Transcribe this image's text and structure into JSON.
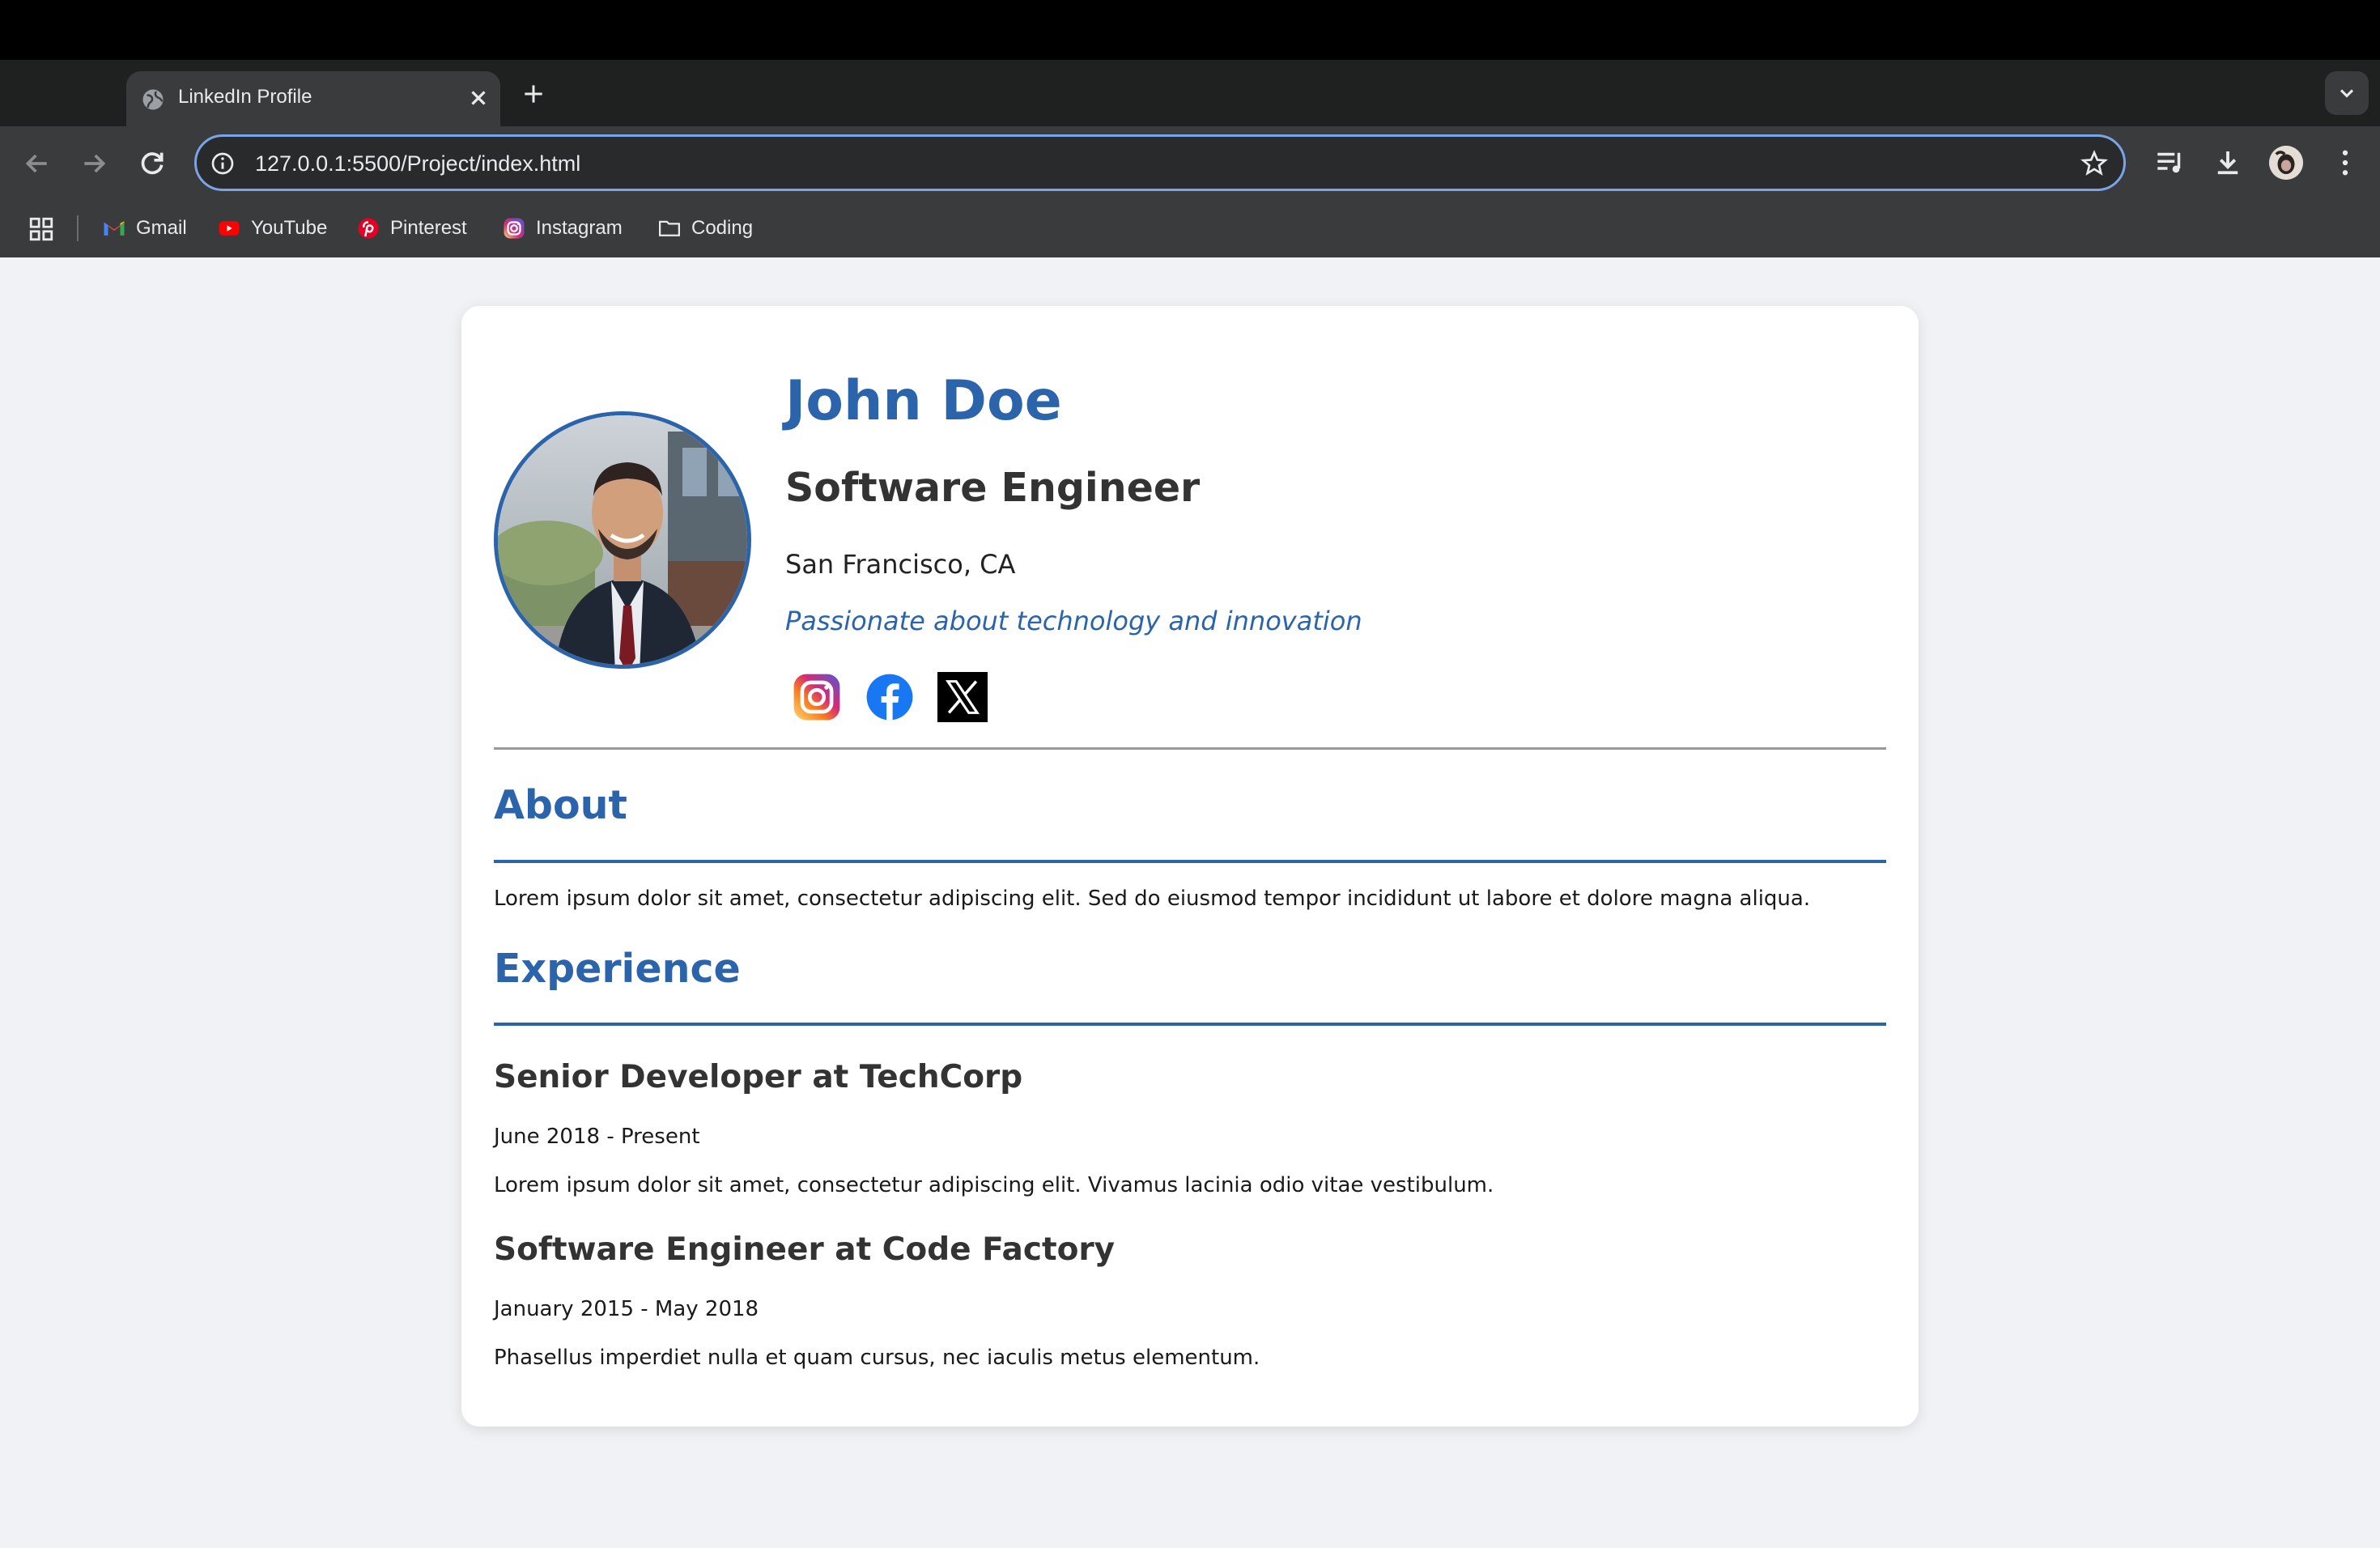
{
  "browser": {
    "tab_title": "LinkedIn Profile",
    "url": "127.0.0.1:5500/Project/index.html",
    "bookmarks": [
      {
        "label": "Gmail",
        "icon": "gmail-icon"
      },
      {
        "label": "YouTube",
        "icon": "youtube-icon"
      },
      {
        "label": "Pinterest",
        "icon": "pinterest-icon"
      },
      {
        "label": "Instagram",
        "icon": "instagram-icon"
      },
      {
        "label": "Coding",
        "icon": "folder-icon"
      }
    ]
  },
  "profile": {
    "name": "John Doe",
    "title": "Software Engineer",
    "location": "San Francisco, CA",
    "tagline": "Passionate about technology and innovation",
    "social": [
      "instagram-icon",
      "facebook-icon",
      "x-icon"
    ]
  },
  "about": {
    "heading": "About",
    "text": "Lorem ipsum dolor sit amet, consectetur adipiscing elit. Sed do eiusmod tempor incididunt ut labore et dolore magna aliqua."
  },
  "experience": {
    "heading": "Experience",
    "jobs": [
      {
        "title": "Senior Developer at TechCorp",
        "dates": "June 2018 - Present",
        "description": "Lorem ipsum dolor sit amet, consectetur adipiscing elit. Vivamus lacinia odio vitae vestibulum."
      },
      {
        "title": "Software Engineer at Code Factory",
        "dates": "January 2015 - May 2018",
        "description": "Phasellus imperdiet nulla et quam cursus, nec iaculis metus elementum."
      }
    ]
  },
  "colors": {
    "accent": "#2c64ab",
    "page_bg": "#f0f2f5",
    "card_bg": "#ffffff"
  }
}
